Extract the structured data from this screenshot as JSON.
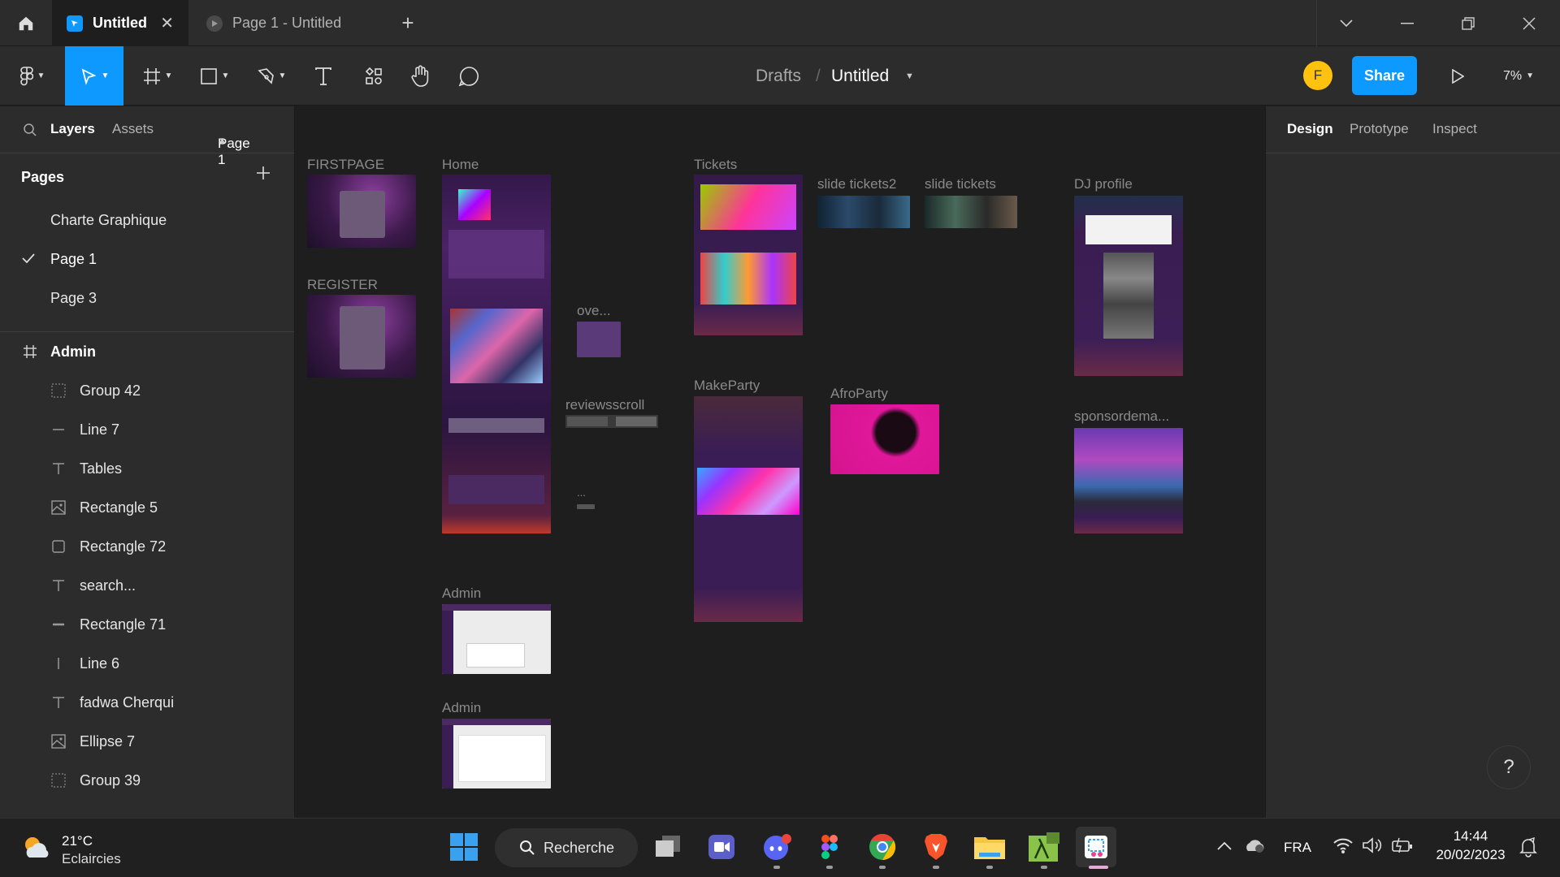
{
  "titlebar": {
    "tabs": [
      {
        "label": "Untitled",
        "active": true
      },
      {
        "label": "Page 1 - Untitled",
        "active": false
      }
    ]
  },
  "toolbar": {
    "breadcrumb_folder": "Drafts",
    "breadcrumb_sep": "/",
    "file_name": "Untitled",
    "avatar_letter": "F",
    "share_label": "Share",
    "zoom": "7%"
  },
  "left_panel": {
    "tabs": [
      "Layers",
      "Assets"
    ],
    "page_selector": "Page 1",
    "pages_title": "Pages",
    "pages": [
      {
        "label": "Charte Graphique",
        "current": false
      },
      {
        "label": "Page 1",
        "current": true
      },
      {
        "label": "Page 3",
        "current": false
      }
    ],
    "frame_label": "Admin",
    "layers": [
      {
        "label": "Group 42",
        "icon": "group-icon"
      },
      {
        "label": "Line 7",
        "icon": "line-icon"
      },
      {
        "label": "Tables",
        "icon": "text-icon"
      },
      {
        "label": "Rectangle 5",
        "icon": "image-icon"
      },
      {
        "label": "Rectangle 72",
        "icon": "rectangle-icon"
      },
      {
        "label": "search...",
        "icon": "text-icon"
      },
      {
        "label": "Rectangle 71",
        "icon": "line-icon"
      },
      {
        "label": "Line 6",
        "icon": "vertical-line-icon"
      },
      {
        "label": "fadwa Cherqui",
        "icon": "text-icon"
      },
      {
        "label": "Ellipse 7",
        "icon": "image-icon"
      },
      {
        "label": "Group 39",
        "icon": "group-icon"
      }
    ]
  },
  "canvas": {
    "frames": {
      "firstpage": "FIRSTPAGE",
      "register": "REGISTER",
      "home": "Home",
      "ove": "ove...",
      "reviewsscroll": "reviewsscroll",
      "dots": "...",
      "tickets": "Tickets",
      "slide_tickets2": "slide tickets2",
      "slide_tickets": "slide tickets",
      "dj_profile": "DJ profile",
      "makeparty": "MakeParty",
      "afroparty": "AfroParty",
      "sponsordema": "sponsordema...",
      "admin1": "Admin",
      "admin2": "Admin"
    }
  },
  "right_panel": {
    "tabs": [
      "Design",
      "Prototype",
      "Inspect"
    ]
  },
  "help_label": "?",
  "taskbar": {
    "weather_temp": "21°C",
    "weather_desc": "Eclaircies",
    "search_label": "Recherche",
    "language": "FRA",
    "time": "14:44",
    "date": "20/02/2023"
  },
  "colors": {
    "accent": "#0d99ff",
    "panel": "#2c2c2c",
    "canvas": "#1e1e1e",
    "avatar": "#ffc20e"
  }
}
